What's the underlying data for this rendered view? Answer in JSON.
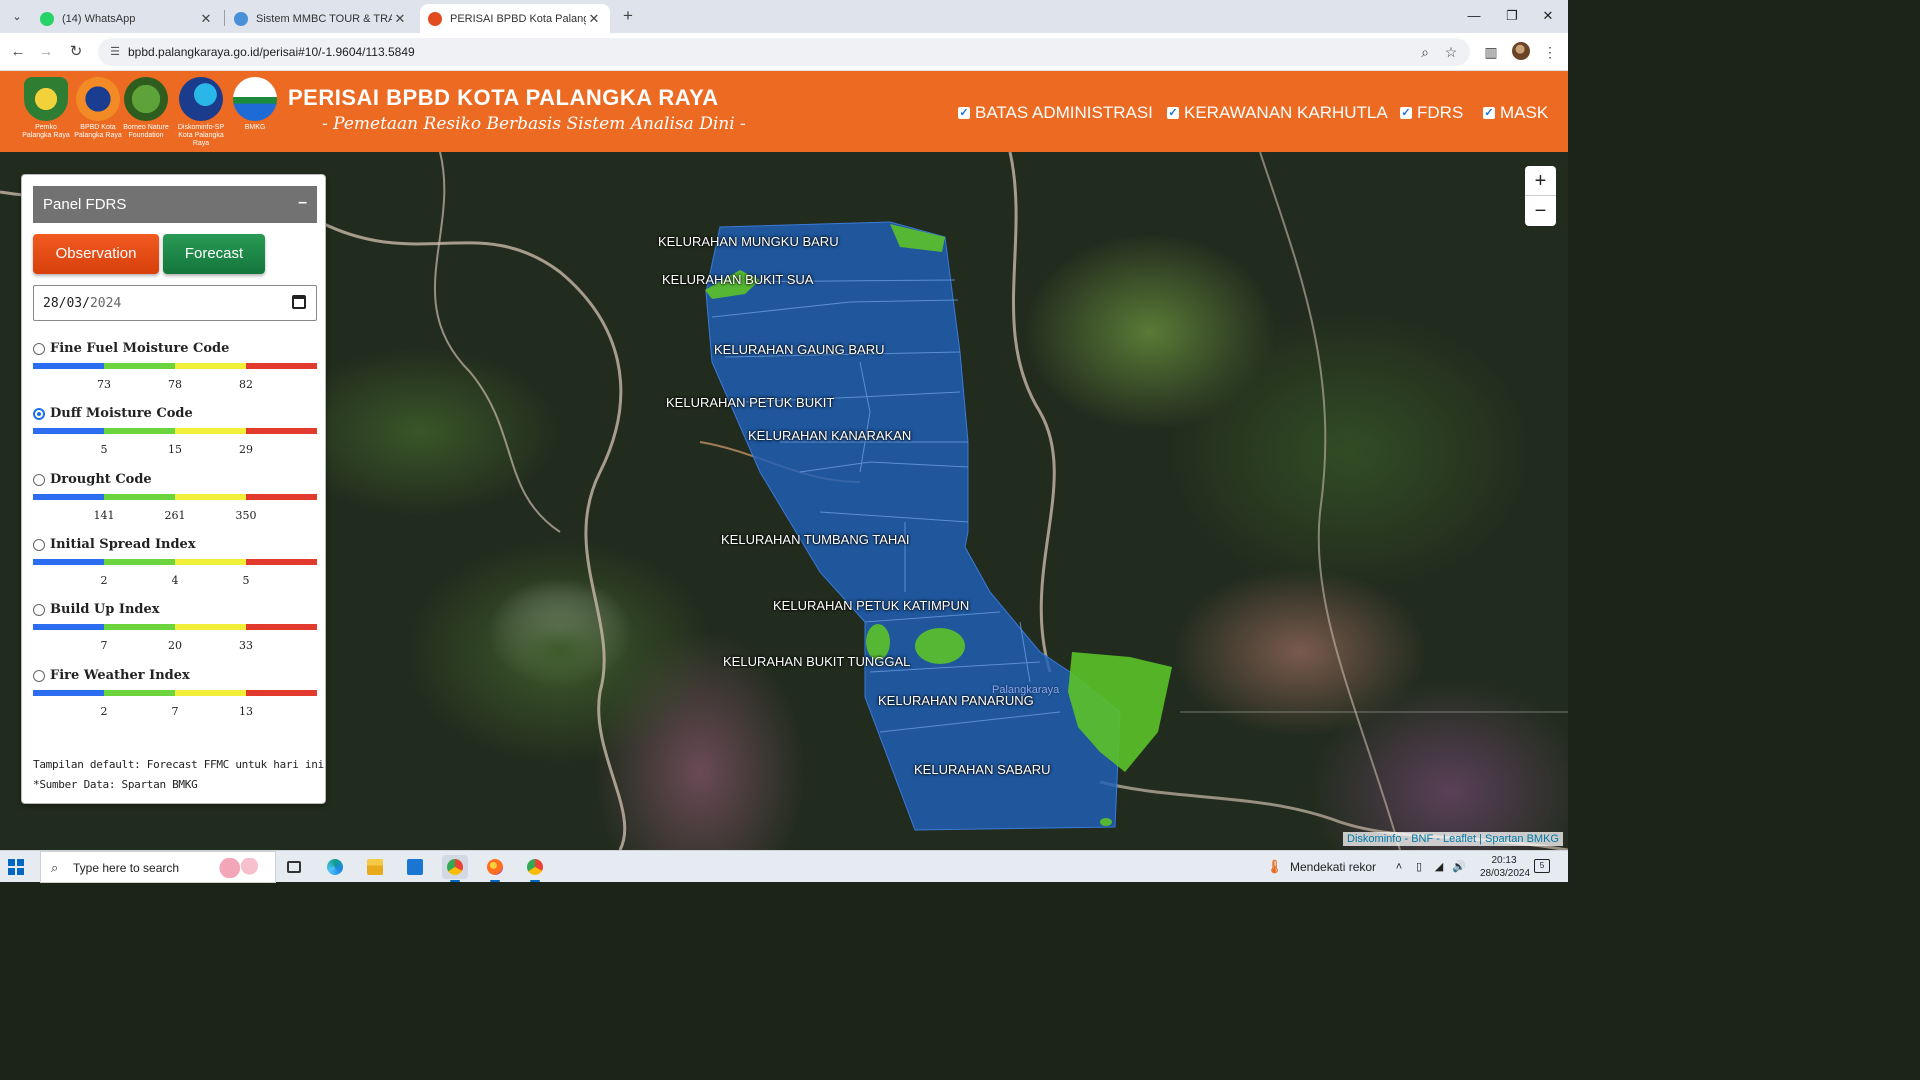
{
  "browser": {
    "tabs": [
      {
        "title": "(14) WhatsApp",
        "icon": "whatsapp-icon",
        "color": "#25d366"
      },
      {
        "title": "Sistem MMBC TOUR & TRAVEL",
        "icon": "cloud-icon",
        "color": "#4a90d9"
      },
      {
        "title": "PERISAI BPBD Kota Palangka Raya",
        "icon": "bpbd-icon",
        "color": "#e24a1f"
      }
    ],
    "url": "bpbd.palangkaraya.go.id/perisai#10/-1.9604/113.5849"
  },
  "header": {
    "logos": [
      {
        "name": "Pemko Palangka Raya",
        "color": "#2e7d32"
      },
      {
        "name": "BPBD Kota Palangka Raya",
        "color": "#1a3d8f"
      },
      {
        "name": "Borneo Nature Foundation",
        "color": "#3b7a2a"
      },
      {
        "name": "Diskominfo-SP Kota Palangka Raya",
        "color": "#1b3c8c"
      },
      {
        "name": "BMKG",
        "color": "#1b8a3a"
      }
    ],
    "title": "PERISAI BPBD KOTA PALANGKA RAYA",
    "subtitle": "- Pemetaan Resiko Berbasis Sistem Analisa Dini -",
    "layers": [
      {
        "label": "BATAS ADMINISTRASI",
        "checked": true
      },
      {
        "label": "KERAWANAN KARHUTLA",
        "checked": true
      },
      {
        "label": "FDRS",
        "checked": true
      },
      {
        "label": "MASK",
        "checked": true
      }
    ]
  },
  "panel": {
    "title": "Panel FDRS",
    "collapse": "–",
    "observation": "Observation",
    "forecast": "Forecast",
    "date": {
      "day": "28",
      "month": "03",
      "year": "2024"
    },
    "scale_colors": [
      "#2b6cf0",
      "#6cd43c",
      "#f2ef3a",
      "#e23b2e"
    ],
    "indices": [
      {
        "name": "Fine Fuel Moisture Code",
        "selected": false,
        "thresholds": [
          "73",
          "78",
          "82"
        ]
      },
      {
        "name": "Duff Moisture Code",
        "selected": true,
        "thresholds": [
          "5",
          "15",
          "29"
        ]
      },
      {
        "name": "Drought Code",
        "selected": false,
        "thresholds": [
          "141",
          "261",
          "350"
        ]
      },
      {
        "name": "Initial Spread Index",
        "selected": false,
        "thresholds": [
          "2",
          "4",
          "5"
        ]
      },
      {
        "name": "Build Up Index",
        "selected": false,
        "thresholds": [
          "7",
          "20",
          "33"
        ]
      },
      {
        "name": "Fire Weather Index",
        "selected": false,
        "thresholds": [
          "2",
          "7",
          "13"
        ]
      }
    ],
    "note1": "Tampilan default: Forecast FFMC untuk hari ini",
    "note2": "*Sumber Data: Spartan BMKG"
  },
  "map": {
    "kelurahan": [
      "KELURAHAN MUNGKU BARU",
      "KELURAHAN BUKIT SUA",
      "KELURAHAN GAUNG BARU",
      "KELURAHAN PETUK BUKIT",
      "KELURAHAN KANARAKAN",
      "KELURAHAN TUMBANG TAHAI",
      "KELURAHAN PETUK KATIMPUN",
      "KELURAHAN BUKIT TUNGGAL",
      "KELURAHAN PANARUNG",
      "KELURAHAN SABARU"
    ],
    "town": "Palangkaraya",
    "region_color": "#1f5fb8",
    "low_risk_color": "#5bc228",
    "zoom_in": "+",
    "zoom_out": "−",
    "attribution": [
      "Diskominfo",
      "BNF",
      "Leaflet",
      "Spartan BMKG"
    ]
  },
  "taskbar": {
    "search_placeholder": "Type here to search",
    "weather": "Mendekati rekor",
    "time": "20:13",
    "date": "28/03/2024",
    "notifications": "5"
  }
}
